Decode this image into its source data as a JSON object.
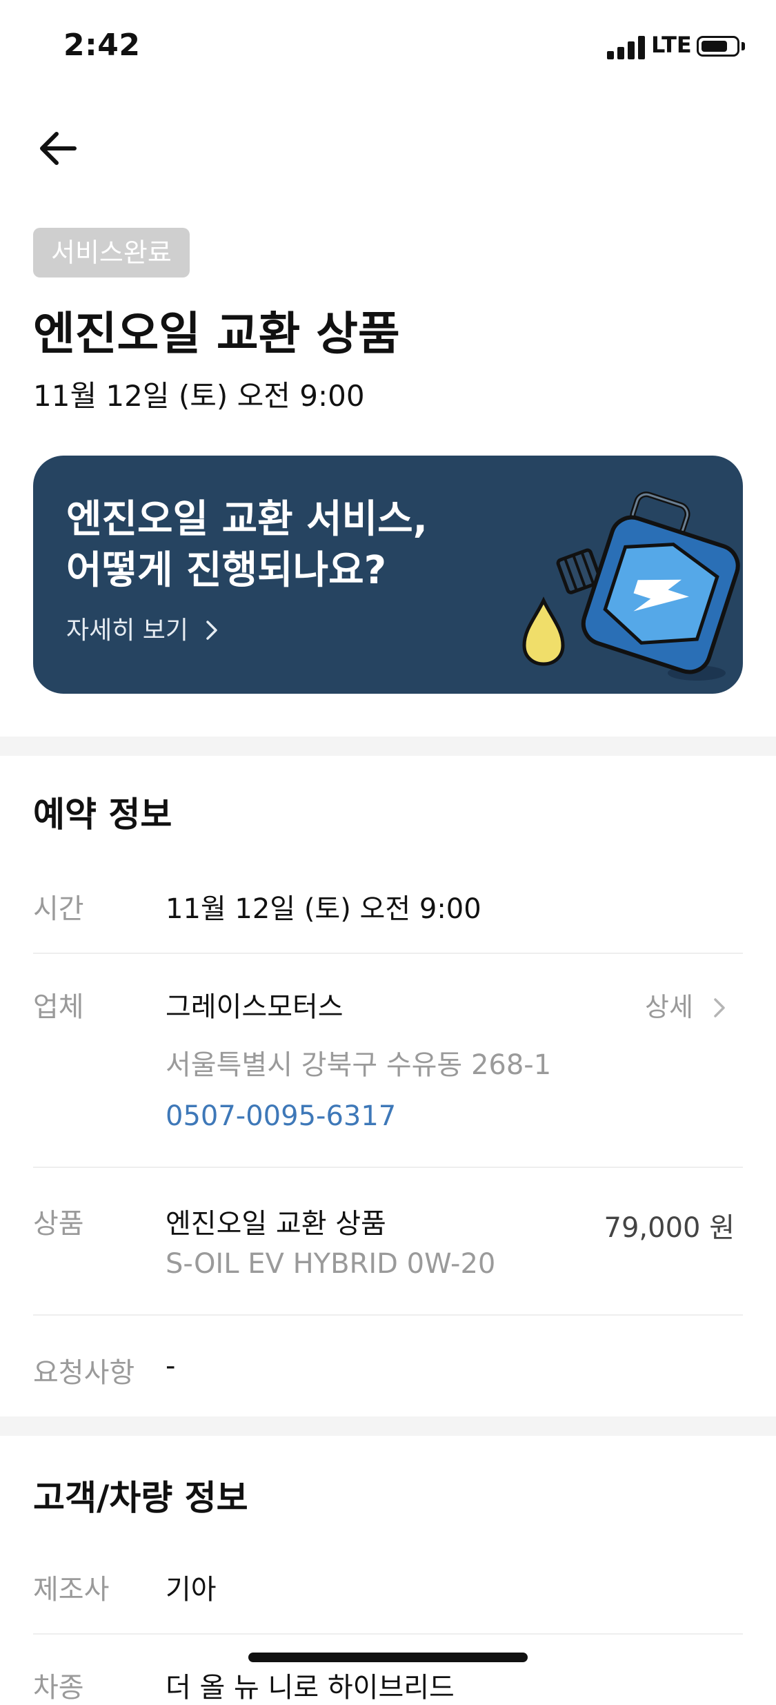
{
  "status_bar": {
    "time": "2:42",
    "network": "LTE",
    "battery_level": 0.66
  },
  "header": {
    "back_icon": "arrow-left-icon"
  },
  "badge": "서비스완료",
  "title": "엔진오일 교환 상품",
  "date": "11월 12일 (토) 오전 9:00",
  "banner": {
    "title": "엔진오일 교환 서비스,\n어떻게 진행되나요?",
    "link": "자세히 보기",
    "link_icon": "chevron-right-icon",
    "illustration": "oil-can-icon",
    "background": "#264461"
  },
  "reservation": {
    "heading": "예약 정보",
    "time_label": "시간",
    "time_value": "11월 12일 (토) 오전 9:00",
    "vendor_label": "업체",
    "vendor_name": "그레이스모터스",
    "vendor_detail": "상세",
    "vendor_address": "서울특별시 강북구 수유동 268-1",
    "vendor_phone": "0507-0095-6317",
    "product_label": "상품",
    "product_name": "엔진오일 교환 상품",
    "product_oil": "S-OIL EV HYBRID 0W-20",
    "product_price": "79,000 원",
    "request_label": "요청사항",
    "request_value": "-"
  },
  "customer": {
    "heading": "고객/차량 정보",
    "maker_label": "제조사",
    "maker_value": "기아",
    "model_label": "차종",
    "model_value": "더 올 뉴 니로 하이브리드"
  },
  "colors": {
    "accent_link": "#3e78b8",
    "muted": "#9a9a9a",
    "badge_bg": "#cfcfcf"
  }
}
